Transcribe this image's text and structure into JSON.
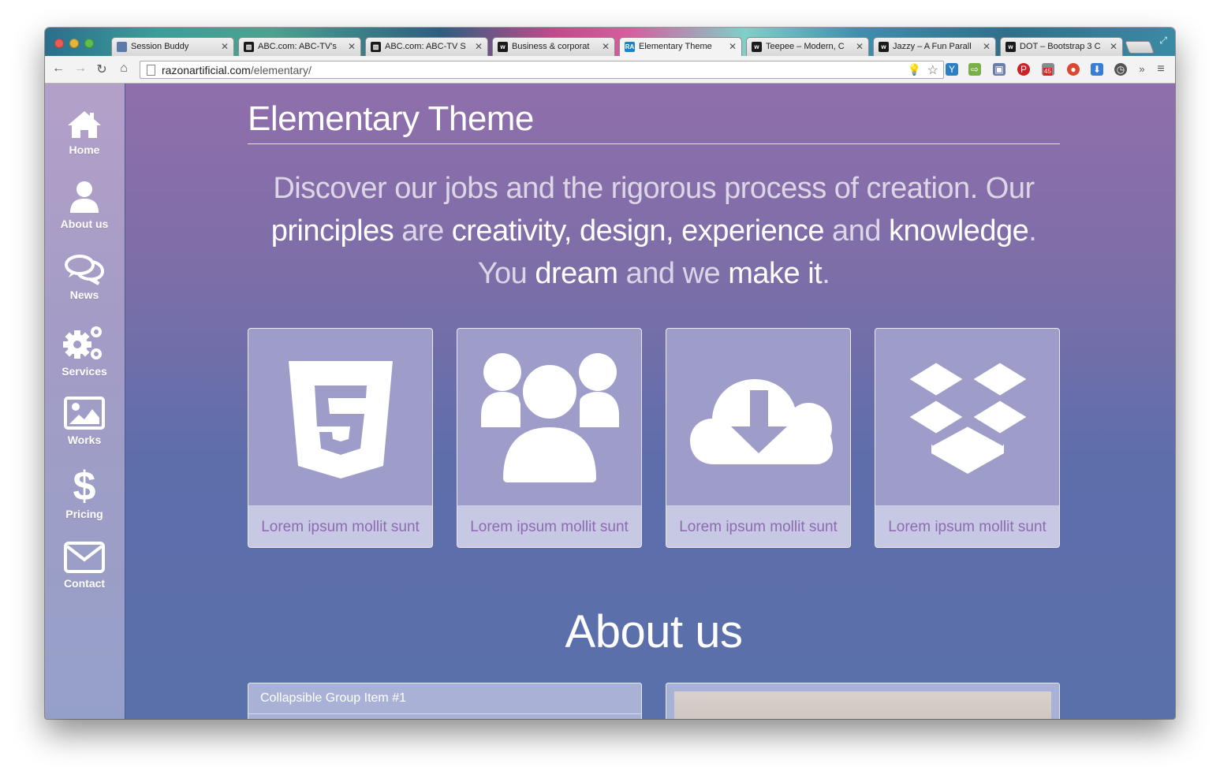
{
  "browser": {
    "tabs": [
      {
        "title": "Session Buddy",
        "favicon": "SB"
      },
      {
        "title": "ABC.com: ABC-TV's",
        "favicon": "ABC"
      },
      {
        "title": "ABC.com: ABC-TV S",
        "favicon": "ABC"
      },
      {
        "title": "Business & corporat",
        "favicon": "w"
      },
      {
        "title": "Elementary Theme",
        "favicon": "RA"
      },
      {
        "title": "Teepee – Modern, C",
        "favicon": "w"
      },
      {
        "title": "Jazzy – A Fun Parall",
        "favicon": "w"
      },
      {
        "title": "DOT – Bootstrap 3 C",
        "favicon": "w"
      }
    ],
    "active_tab": 4,
    "url_host": "razonartificial.com",
    "url_path": "/elementary/",
    "extension_badge": "45"
  },
  "sidebar": {
    "items": [
      {
        "label": "Home",
        "icon": "home-icon"
      },
      {
        "label": "About us",
        "icon": "user-icon"
      },
      {
        "label": "News",
        "icon": "chat-bubbles-icon"
      },
      {
        "label": "Services",
        "icon": "gears-icon"
      },
      {
        "label": "Works",
        "icon": "picture-icon"
      },
      {
        "label": "Pricing",
        "icon": "dollar-icon"
      },
      {
        "label": "Contact",
        "icon": "envelope-icon"
      }
    ]
  },
  "main": {
    "title": "Elementary Theme",
    "lead": {
      "p1": "Discover our jobs and the rigorous process of creation. Our",
      "w_principles": "principles",
      "t_are": " are ",
      "w_creativity": "creativity, design, experience",
      "t_and": " and ",
      "w_knowledge": "knowledge",
      "t_period": ".",
      "t_you": "You ",
      "w_dream": "dream",
      "t_andwe": " and we ",
      "w_make": "make it",
      "t_end": "."
    },
    "cards": [
      {
        "icon": "html5-icon",
        "caption": "Lorem ipsum mollit sunt"
      },
      {
        "icon": "users-group-icon",
        "caption": "Lorem ipsum mollit sunt"
      },
      {
        "icon": "cloud-download-icon",
        "caption": "Lorem ipsum mollit sunt"
      },
      {
        "icon": "dropbox-icon",
        "caption": "Lorem ipsum mollit sunt"
      }
    ],
    "about_title": "About us",
    "accordion_item": "Collapsible Group Item #1"
  },
  "colors": {
    "page_top": "#8f6fab",
    "page_bottom": "#5a70ab",
    "card_bg": "#9e9cc8",
    "caption_bg": "#c7c8e4",
    "caption_text": "#8d6bb0"
  }
}
